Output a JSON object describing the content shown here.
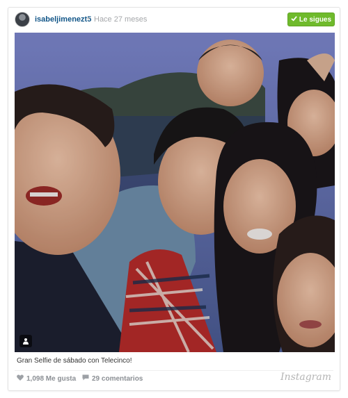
{
  "post": {
    "username": "isabeljimenezt5",
    "separator": "•",
    "time_ago": "Hace 27 meses",
    "follow_label": "Le sigues",
    "caption": "Gran Selfie de sábado con Telecinco!",
    "likes": "1,098 Me gusta",
    "comments": "29 comentarios",
    "brand": "Instagram"
  },
  "colors": {
    "username": "#125688",
    "follow_button": "#6fba2c",
    "meta_text": "#8b8f94"
  },
  "icons": {
    "follow": "check-icon",
    "tag": "user-tag-icon",
    "likes": "heart-icon",
    "comments": "speech-bubble-icon"
  }
}
